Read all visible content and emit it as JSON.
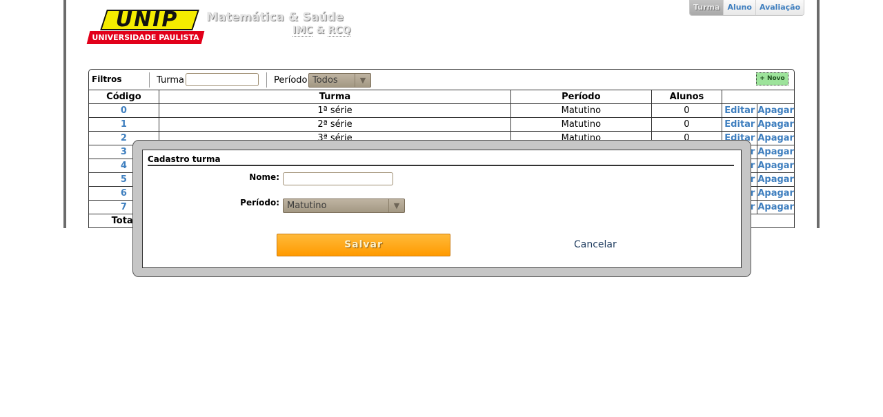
{
  "header": {
    "logo_top": "UNIP",
    "logo_bottom": "UNIVERSIDADE PAULISTA",
    "title": "Matemática & Saúde",
    "sub_a": "IMC",
    "sub_amp": "&",
    "sub_b": "RCQ"
  },
  "nav": {
    "tabs": [
      {
        "label": "Turma",
        "active": true
      },
      {
        "label": "Aluno",
        "active": false
      },
      {
        "label": "Avaliação",
        "active": false
      }
    ]
  },
  "filters": {
    "heading": "Filtros",
    "turma_label": "Turma",
    "turma_value": "",
    "periodo_label": "Período",
    "periodo_value": "Todos",
    "new_button": "+ Novo"
  },
  "table": {
    "headers": [
      "Código",
      "Turma",
      "Período",
      "Alunos"
    ],
    "rows": [
      {
        "codigo": "0",
        "turma": "1ª série",
        "periodo": "Matutino",
        "alunos": "0",
        "edit": "Editar",
        "delete": "Apagar"
      },
      {
        "codigo": "1",
        "turma": "2ª série",
        "periodo": "Matutino",
        "alunos": "0",
        "edit": "Editar",
        "delete": "Apagar"
      },
      {
        "codigo": "2",
        "turma": "3ª série",
        "periodo": "Matutino",
        "alunos": "0",
        "edit": "Editar",
        "delete": "Apagar"
      },
      {
        "codigo": "3",
        "turma": "",
        "periodo": "",
        "alunos": "",
        "edit": "Editar",
        "delete": "Apagar"
      },
      {
        "codigo": "4",
        "turma": "",
        "periodo": "",
        "alunos": "",
        "edit": "Editar",
        "delete": "Apagar"
      },
      {
        "codigo": "5",
        "turma": "",
        "periodo": "",
        "alunos": "",
        "edit": "Editar",
        "delete": "Apagar"
      },
      {
        "codigo": "6",
        "turma": "",
        "periodo": "",
        "alunos": "",
        "edit": "Editar",
        "delete": "Apagar"
      },
      {
        "codigo": "7",
        "turma": "",
        "periodo": "",
        "alunos": "",
        "edit": "Editar",
        "delete": "Apagar"
      }
    ],
    "total_label": "Total"
  },
  "modal": {
    "title": "Cadastro turma",
    "nome_label": "Nome:",
    "nome_value": "",
    "periodo_label": "Período:",
    "periodo_value": "Matutino",
    "save_label": "Salvar",
    "cancel_label": "Cancelar"
  },
  "colors": {
    "link": "#3f7fbf",
    "save_button": "#ff9a00",
    "new_button": "#9de39b",
    "logo_yellow": "#f5ec00",
    "logo_red": "#e2001a"
  }
}
